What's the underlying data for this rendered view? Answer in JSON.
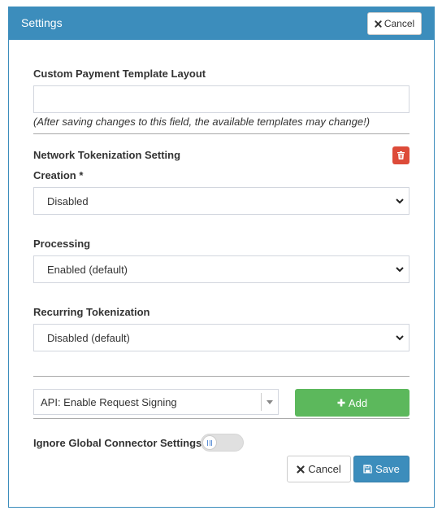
{
  "header": {
    "title": "Settings",
    "cancel_label": "Cancel"
  },
  "custom_template": {
    "label": "Custom Payment Template Layout",
    "value": "",
    "help": "(After saving changes to this field, the available templates may change!)"
  },
  "network_tokenization": {
    "heading": "Network Tokenization Setting",
    "creation": {
      "label": "Creation *",
      "selected": "Disabled"
    },
    "processing": {
      "label": "Processing",
      "selected": "Enabled (default)"
    },
    "recurring": {
      "label": "Recurring Tokenization",
      "selected": "Disabled (default)"
    }
  },
  "add_setting": {
    "selected": "API: Enable Request Signing",
    "add_label": "Add"
  },
  "ignore_global": {
    "label": "Ignore Global Connector Settings",
    "enabled": false
  },
  "footer": {
    "cancel_label": "Cancel",
    "save_label": "Save"
  },
  "colors": {
    "primary": "#3c8dbc",
    "success": "#5cb85c",
    "danger": "#dd4b39"
  },
  "icons": {
    "cancel": "close-icon",
    "delete": "trash-icon",
    "add": "plus-icon",
    "save": "floppy-disk-icon",
    "select": "chevron-down-icon"
  }
}
